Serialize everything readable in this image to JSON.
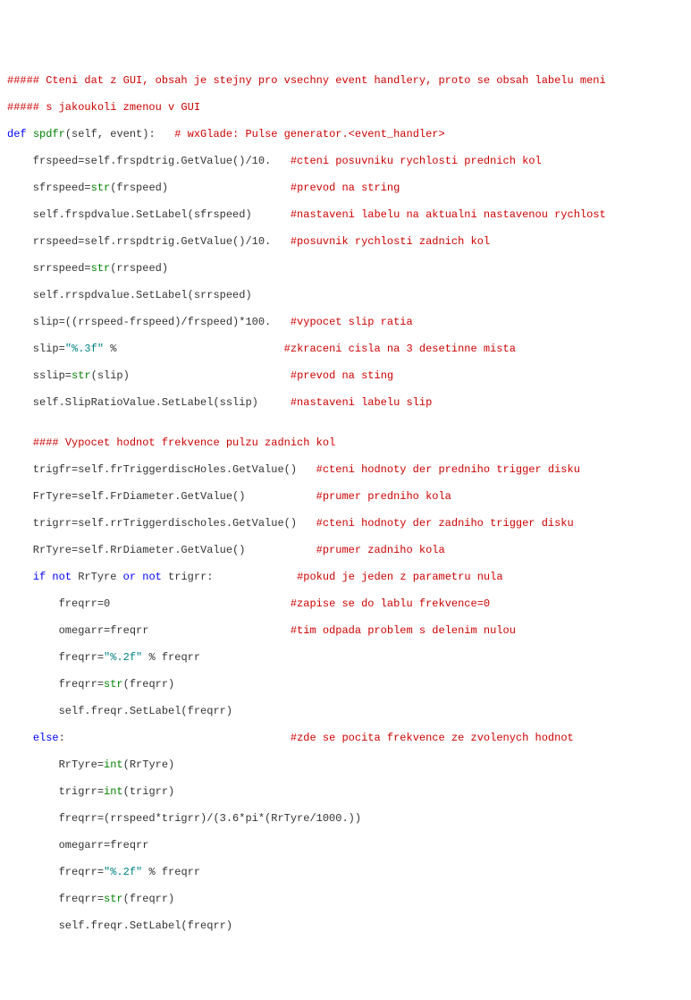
{
  "code": {
    "l00a": "##### Cteni dat z GUI, obsah je stejny pro vsechny event handlery, proto se obsah labelu meni",
    "l00b": "##### s jakoukoli zmenou v GUI",
    "l01_kw": "def",
    "l01_name": "spdfr",
    "l01_args": "(self, event):   ",
    "l01_comment": "# wxGlade: Pulse generator.<event_handler>",
    "l02_code": "    frspeed=self.frspdtrig.GetValue()/10.   ",
    "l02_comment": "#cteni posuvniku rychlosti prednich kol",
    "l03_code_a": "    sfrspeed=",
    "l03_code_b": "(frspeed)                   ",
    "l03_comment": "#prevod na string",
    "l04_code": "    self.frspdvalue.SetLabel(sfrspeed)      ",
    "l04_comment": "#nastaveni labelu na aktualni nastavenou rychlost",
    "l05_code": "    rrspeed=self.rrspdtrig.GetValue()/10.   ",
    "l05_comment": "#posuvnik rychlosti zadnich kol",
    "l06_code_a": "    srrspeed=",
    "l06_code_b": "(rrspeed)",
    "l07_code": "    self.rrspdvalue.SetLabel(srrspeed)",
    "l08_code": "    slip=((rrspeed-frspeed)/frspeed)*100.   ",
    "l08_comment": "#vypocet slip ratia",
    "l09_code_a": "    slip=",
    "l09_str": "\"%.3f\"",
    "l09_code_b": " %                          ",
    "l09_comment": "#zkraceni cisla na 3 desetinne mista",
    "l10_code_a": "    sslip=",
    "l10_code_b": "(slip)                         ",
    "l10_comment": "#prevod na sting",
    "l11_code": "    self.SlipRatioValue.SetLabel(sslip)     ",
    "l11_comment": "#nastaveni labelu slip",
    "blank1": "",
    "l12_indent": "    ",
    "l12_comment": "#### Vypocet hodnot frekvence pulzu zadnich kol",
    "l13_code": "    trigfr=self.frTriggerdiscHoles.GetValue()   ",
    "l13_comment": "#cteni hodnoty der predniho trigger disku",
    "l14_code": "    FrTyre=self.FrDiameter.GetValue()           ",
    "l14_comment": "#prumer predniho kola",
    "l15_code": "    trigrr=self.rrTriggerdischoles.GetValue()   ",
    "l15_comment": "#cteni hodnoty der zadniho trigger disku",
    "l16_code": "    RrTyre=self.RrDiameter.GetValue()           ",
    "l16_comment": "#prumer zadniho kola",
    "l17_a": "    ",
    "l17_if": "if",
    "l17_b": " ",
    "l17_not1": "not",
    "l17_c": " RrTyre ",
    "l17_or": "or",
    "l17_d": " ",
    "l17_not2": "not",
    "l17_e": " trigrr:             ",
    "l17_comment": "#pokud je jeden z parametru nula",
    "l18_code": "        freqrr=0                            ",
    "l18_comment": "#zapise se do lablu frekvence=0",
    "l19_code": "        omegarr=freqrr                      ",
    "l19_comment": "#tim odpada problem s delenim nulou",
    "l20_code_a": "        freqrr=",
    "l20_str": "\"%.2f\"",
    "l20_code_b": " % freqrr",
    "l21_code_a": "        freqrr=",
    "l21_code_b": "(freqrr)",
    "l22_code": "        self.freqr.SetLabel(freqrr)",
    "l23_a": "    ",
    "l23_else": "else",
    "l23_b": ":                                   ",
    "l23_comment": "#zde se pocita frekvence ze zvolenych hodnot",
    "l24_code_a": "        RrTyre=",
    "l24_code_b": "(RrTyre)",
    "l25_code_a": "        trigrr=",
    "l25_code_b": "(trigrr)",
    "l26_code": "        freqrr=(rrspeed*trigrr)/(3.6*pi*(RrTyre/1000.))",
    "l27_code": "        omegarr=freqrr",
    "l28_code_a": "        freqrr=",
    "l28_str": "\"%.2f\"",
    "l28_code_b": " % freqrr",
    "l29_code_a": "        freqrr=",
    "l29_code_b": "(freqrr)",
    "l30_code": "        self.freqr.SetLabel(freqrr)"
  },
  "builtins": {
    "str": "str",
    "int": "int"
  }
}
